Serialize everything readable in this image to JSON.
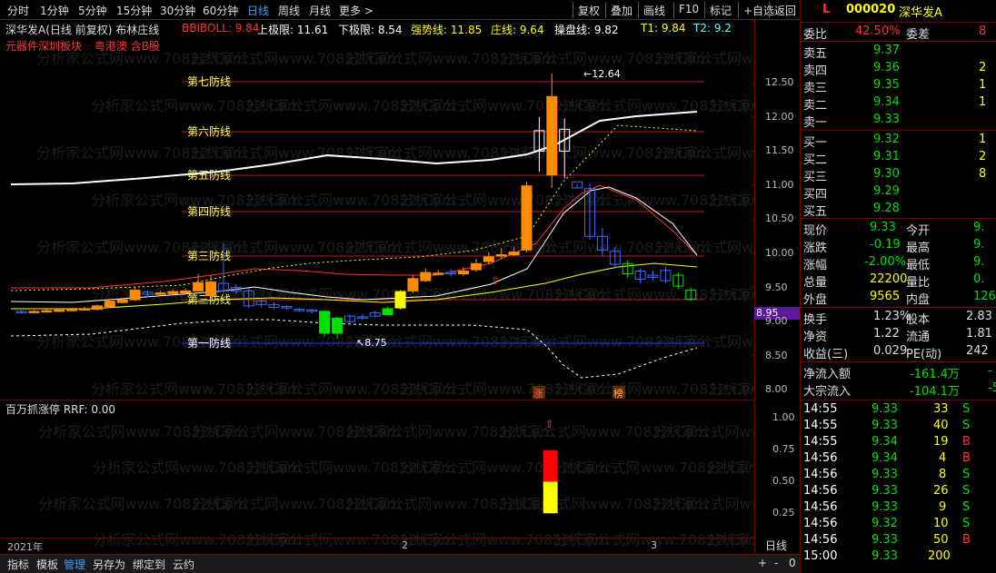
{
  "toolbar": {
    "periods": [
      "分时",
      "1分钟",
      "5分钟",
      "15分钟",
      "30分钟",
      "60分钟",
      "日线",
      "周线",
      "月线",
      "更多 >"
    ],
    "active_period": "日线",
    "buttons": [
      "复权",
      "叠加",
      "画线",
      "F10",
      "标记",
      "+自选",
      "返回"
    ]
  },
  "indicator_line": {
    "stock": "深华发A(日线 前复权) 布林庄线",
    "bbiboll": "BBIBOLL: 9.84",
    "upper": "上极限: 11.61",
    "lower": "下极限: 8.54",
    "strong": "强势线: 11.85",
    "zhuang": "庄线: 9.64",
    "caopan": "操盘线: 9.82",
    "t1": "T1: 9.84",
    "t2": "T2: 9.2"
  },
  "sector_tags": [
    "元器件",
    "深圳板块",
    "粤港澳",
    "含B股"
  ],
  "defense_lines": [
    "第七防线",
    "第六防线",
    "第五防线",
    "第四防线",
    "第三防线",
    "第三防线",
    "第一防线"
  ],
  "price_axis": [
    "12.50",
    "12.00",
    "11.50",
    "11.00",
    "10.50",
    "10.00",
    "9.50",
    "9.00",
    "8.50",
    "8.00"
  ],
  "current_price_tag": "8.95",
  "annotations": {
    "high": "12.64",
    "low": "8.75",
    "zhang": "涨",
    "bang": "榜"
  },
  "sub_indicator": {
    "title": "百万抓涨停 RRF: 0.00",
    "axis": [
      "1.00",
      "0.75",
      "0.50",
      "0.25"
    ]
  },
  "date_axis": [
    "2021年",
    "2",
    "3"
  ],
  "date_axis_label": "日线",
  "bottom_bar": [
    "指标",
    "模板",
    "管理",
    "另存为",
    "绑定到",
    "云约"
  ],
  "right_panel": {
    "header": {
      "flag": "L",
      "code": "000020",
      "name": "深华发A"
    },
    "weibi": {
      "label1": "委比",
      "value1": "42.50%",
      "label2": "委差",
      "value2": "8"
    },
    "sell": [
      {
        "label": "卖五",
        "price": "9.37",
        "vol": ""
      },
      {
        "label": "卖四",
        "price": "9.36",
        "vol": "2"
      },
      {
        "label": "卖三",
        "price": "9.35",
        "vol": "1"
      },
      {
        "label": "卖二",
        "price": "9.34",
        "vol": "1"
      },
      {
        "label": "卖一",
        "price": "9.33",
        "vol": ""
      }
    ],
    "buy": [
      {
        "label": "买一",
        "price": "9.32",
        "vol": "1"
      },
      {
        "label": "买二",
        "price": "9.31",
        "vol": "2"
      },
      {
        "label": "买三",
        "price": "9.30",
        "vol": "8"
      },
      {
        "label": "买四",
        "price": "9.29",
        "vol": ""
      },
      {
        "label": "买五",
        "price": "9.28",
        "vol": ""
      }
    ],
    "stats": [
      {
        "l1": "现价",
        "v1": "9.33",
        "l2": "今开",
        "v2": "9."
      },
      {
        "l1": "涨跌",
        "v1": "-0.19",
        "l2": "最高",
        "v2": "9."
      },
      {
        "l1": "涨幅",
        "v1": "-2.00%",
        "l2": "最低",
        "v2": "9."
      },
      {
        "l1": "总量",
        "v1": "22200",
        "l2": "量比",
        "v2": "0."
      },
      {
        "l1": "外盘",
        "v1": "9565",
        "l2": "内盘",
        "v2": "126"
      }
    ],
    "stats2": [
      {
        "l1": "换手",
        "v1": "1.23%",
        "l2": "股本",
        "v2": "2.83"
      },
      {
        "l1": "净资",
        "v1": "1.22",
        "l2": "流通",
        "v2": "1.81"
      },
      {
        "l1": "收益(三)",
        "v1": "0.029",
        "l2": "PE(动)",
        "v2": "242"
      }
    ],
    "flows": [
      {
        "label": "净流入额",
        "value": "-161.4万",
        "tail": "-"
      },
      {
        "label": "大宗流入",
        "value": "-104.1万",
        "tail": "-5"
      }
    ],
    "ticks": [
      {
        "time": "14:55",
        "price": "9.33",
        "vol": "33",
        "side": "S"
      },
      {
        "time": "14:55",
        "price": "9.33",
        "vol": "40",
        "side": "S"
      },
      {
        "time": "14:55",
        "price": "9.34",
        "vol": "19",
        "side": "B"
      },
      {
        "time": "14:56",
        "price": "9.34",
        "vol": "4",
        "side": "B"
      },
      {
        "time": "14:56",
        "price": "9.33",
        "vol": "8",
        "side": "S"
      },
      {
        "time": "14:56",
        "price": "9.33",
        "vol": "26",
        "side": "S"
      },
      {
        "time": "14:56",
        "price": "9.33",
        "vol": "9",
        "side": "S"
      },
      {
        "time": "14:56",
        "price": "9.32",
        "vol": "10",
        "side": "S"
      },
      {
        "time": "14:56",
        "price": "9.33",
        "vol": "50",
        "side": "B"
      },
      {
        "time": "15:00",
        "price": "9.33",
        "vol": "200",
        "side": ""
      }
    ]
  },
  "colors": {
    "up": "#ff3232",
    "down": "#54ffff",
    "green": "#00e000",
    "yellow": "#ffff00",
    "white": "#ffffff",
    "orange": "#ff8c00",
    "darkred": "#7a0000",
    "blue": "#3aa0ff"
  },
  "chart_data": {
    "type": "candlestick",
    "ylim": [
      7.95,
      12.85
    ],
    "candles": [
      {
        "o": 9.13,
        "c": 9.15,
        "h": 9.17,
        "l": 9.12,
        "up": false
      },
      {
        "o": 9.14,
        "c": 9.15,
        "h": 9.17,
        "l": 9.12,
        "up": true
      },
      {
        "o": 9.15,
        "c": 9.16,
        "h": 9.18,
        "l": 9.13,
        "up": true
      },
      {
        "o": 9.15,
        "c": 9.17,
        "h": 9.19,
        "l": 9.14,
        "up": true
      },
      {
        "o": 9.16,
        "c": 9.18,
        "h": 9.2,
        "l": 9.15,
        "up": true
      },
      {
        "o": 9.17,
        "c": 9.19,
        "h": 9.22,
        "l": 9.16,
        "up": true
      },
      {
        "o": 9.18,
        "c": 9.23,
        "h": 9.25,
        "l": 9.17,
        "up": true
      },
      {
        "o": 9.22,
        "c": 9.3,
        "h": 9.33,
        "l": 9.2,
        "up": true
      },
      {
        "o": 9.28,
        "c": 9.32,
        "h": 9.34,
        "l": 9.27,
        "up": true
      },
      {
        "o": 9.32,
        "c": 9.46,
        "h": 9.52,
        "l": 9.3,
        "up": true
      },
      {
        "o": 9.43,
        "c": 9.4,
        "h": 9.46,
        "l": 9.36,
        "up": false
      },
      {
        "o": 9.4,
        "c": 9.42,
        "h": 9.45,
        "l": 9.37,
        "up": true
      },
      {
        "o": 9.41,
        "c": 9.44,
        "h": 9.47,
        "l": 9.38,
        "up": true
      },
      {
        "o": 9.42,
        "c": 9.45,
        "h": 9.48,
        "l": 9.4,
        "up": true
      },
      {
        "o": 9.45,
        "c": 9.57,
        "h": 9.7,
        "l": 9.44,
        "up": true
      },
      {
        "o": 9.58,
        "c": 9.38,
        "h": 9.68,
        "l": 9.34,
        "up": true
      },
      {
        "o": 9.56,
        "c": 9.45,
        "h": 10.15,
        "l": 9.42,
        "up": false
      },
      {
        "o": 9.5,
        "c": 9.45,
        "h": 9.55,
        "l": 9.4,
        "up": false
      },
      {
        "o": 9.45,
        "c": 9.23,
        "h": 9.48,
        "l": 9.2,
        "up": false
      },
      {
        "o": 9.3,
        "c": 9.25,
        "h": 9.34,
        "l": 9.2,
        "up": false
      },
      {
        "o": 9.25,
        "c": 9.21,
        "h": 9.28,
        "l": 9.18,
        "up": false
      },
      {
        "o": 9.22,
        "c": 9.2,
        "h": 9.24,
        "l": 9.17,
        "up": false
      },
      {
        "o": 9.18,
        "c": 9.17,
        "h": 9.2,
        "l": 9.14,
        "up": false
      },
      {
        "o": 9.17,
        "c": 9.15,
        "h": 9.19,
        "l": 9.12,
        "up": false
      },
      {
        "o": 9.15,
        "c": 8.83,
        "h": 9.16,
        "l": 8.78,
        "up": false,
        "fill": "green"
      },
      {
        "o": 8.83,
        "c": 9.05,
        "h": 9.07,
        "l": 8.75,
        "up": false,
        "fill": "green"
      },
      {
        "o": 9.0,
        "c": 9.08,
        "h": 9.1,
        "l": 8.98,
        "up": false
      },
      {
        "o": 9.05,
        "c": 9.07,
        "h": 9.11,
        "l": 9.02,
        "up": false
      },
      {
        "o": 9.08,
        "c": 9.13,
        "h": 9.16,
        "l": 9.06,
        "up": false
      },
      {
        "o": 9.1,
        "c": 9.19,
        "h": 9.22,
        "l": 9.1,
        "up": false,
        "fill": "green"
      },
      {
        "o": 9.2,
        "c": 9.44,
        "h": 9.46,
        "l": 9.18,
        "up": true,
        "fill": "yellow"
      },
      {
        "o": 9.45,
        "c": 9.63,
        "h": 9.68,
        "l": 9.42,
        "up": true
      },
      {
        "o": 9.6,
        "c": 9.72,
        "h": 9.78,
        "l": 9.58,
        "up": true
      },
      {
        "o": 9.71,
        "c": 9.71,
        "h": 9.76,
        "l": 9.68,
        "up": true
      },
      {
        "o": 9.72,
        "c": 9.7,
        "h": 9.77,
        "l": 9.66,
        "up": false
      },
      {
        "o": 9.7,
        "c": 9.74,
        "h": 9.8,
        "l": 9.67,
        "up": true
      },
      {
        "o": 9.76,
        "c": 9.85,
        "h": 9.92,
        "l": 9.73,
        "up": true
      },
      {
        "o": 9.88,
        "c": 9.95,
        "h": 10.02,
        "l": 9.84,
        "up": true
      },
      {
        "o": 9.96,
        "c": 9.98,
        "h": 10.08,
        "l": 9.92,
        "up": true
      },
      {
        "o": 9.98,
        "c": 10.02,
        "h": 10.1,
        "l": 9.96,
        "up": true
      },
      {
        "o": 10.05,
        "c": 10.99,
        "h": 11.05,
        "l": 10.02,
        "up": true
      },
      {
        "o": 11.5,
        "c": 11.8,
        "h": 12.0,
        "l": 11.2,
        "up": true,
        "hollow": true
      },
      {
        "o": 11.15,
        "c": 12.3,
        "h": 12.64,
        "l": 10.96,
        "up": true
      },
      {
        "o": 11.5,
        "c": 11.82,
        "h": 11.98,
        "l": 11.1,
        "up": true,
        "hollow": true
      },
      {
        "o": 11.05,
        "c": 10.96,
        "h": 11.02,
        "l": 10.95,
        "up": false
      },
      {
        "o": 10.95,
        "c": 10.25,
        "h": 11.02,
        "l": 10.2,
        "up": false
      },
      {
        "o": 10.25,
        "c": 10.05,
        "h": 10.37,
        "l": 9.95,
        "up": false
      },
      {
        "o": 10.03,
        "c": 9.84,
        "h": 10.1,
        "l": 9.77,
        "up": false
      },
      {
        "o": 9.85,
        "c": 9.7,
        "h": 9.9,
        "l": 9.64,
        "up": false,
        "hollow_green": true
      },
      {
        "o": 9.74,
        "c": 9.62,
        "h": 9.78,
        "l": 9.56,
        "up": false
      },
      {
        "o": 9.68,
        "c": 9.65,
        "h": 9.74,
        "l": 9.6,
        "up": false
      },
      {
        "o": 9.75,
        "c": 9.6,
        "h": 9.8,
        "l": 9.56,
        "up": false
      },
      {
        "o": 9.68,
        "c": 9.52,
        "h": 9.72,
        "l": 9.48,
        "up": false,
        "hollow_green": true
      },
      {
        "o": 9.46,
        "c": 9.33,
        "h": 9.5,
        "l": 9.3,
        "up": false,
        "hollow_green": true
      }
    ],
    "sub_bars": [
      {
        "index": 42,
        "red": [
          0.5,
          0.75
        ],
        "yellow": [
          0.25,
          0.5
        ]
      }
    ]
  }
}
